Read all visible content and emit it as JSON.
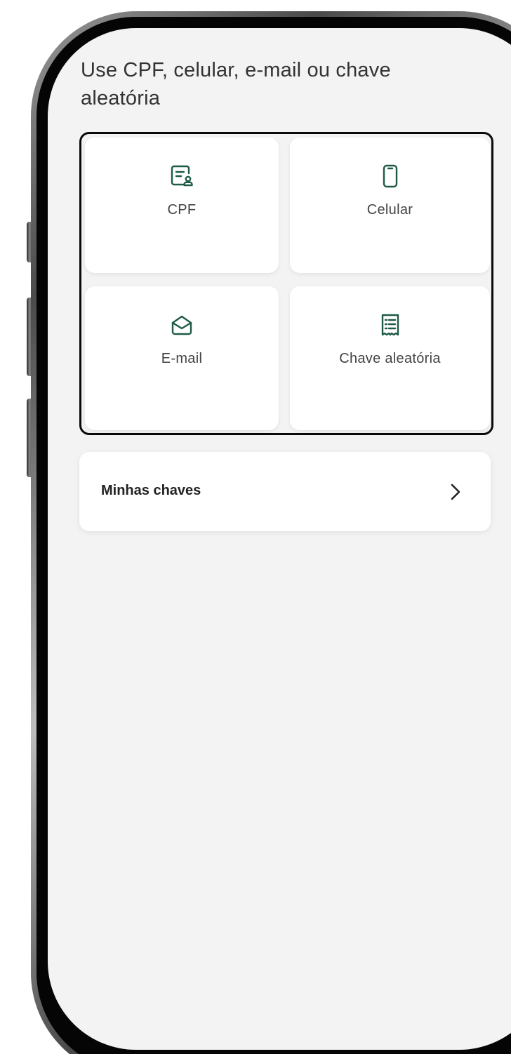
{
  "screen": {
    "title": "Use CPF, celular, e-mail ou chave aleatória"
  },
  "key_types": [
    {
      "label": "CPF",
      "icon": "id-card-icon"
    },
    {
      "label": "Celular",
      "icon": "smartphone-icon"
    },
    {
      "label": "E-mail",
      "icon": "envelope-open-icon"
    },
    {
      "label": "Chave aleatória",
      "icon": "receipt-list-icon"
    }
  ],
  "my_keys": {
    "label": "Minhas chaves",
    "icon": "chevron-right-icon"
  },
  "colors": {
    "icon_green": "#1f5a46",
    "screen_background": "#f3f3f3",
    "card_background": "#ffffff",
    "highlight_border": "#0a0a0a"
  }
}
